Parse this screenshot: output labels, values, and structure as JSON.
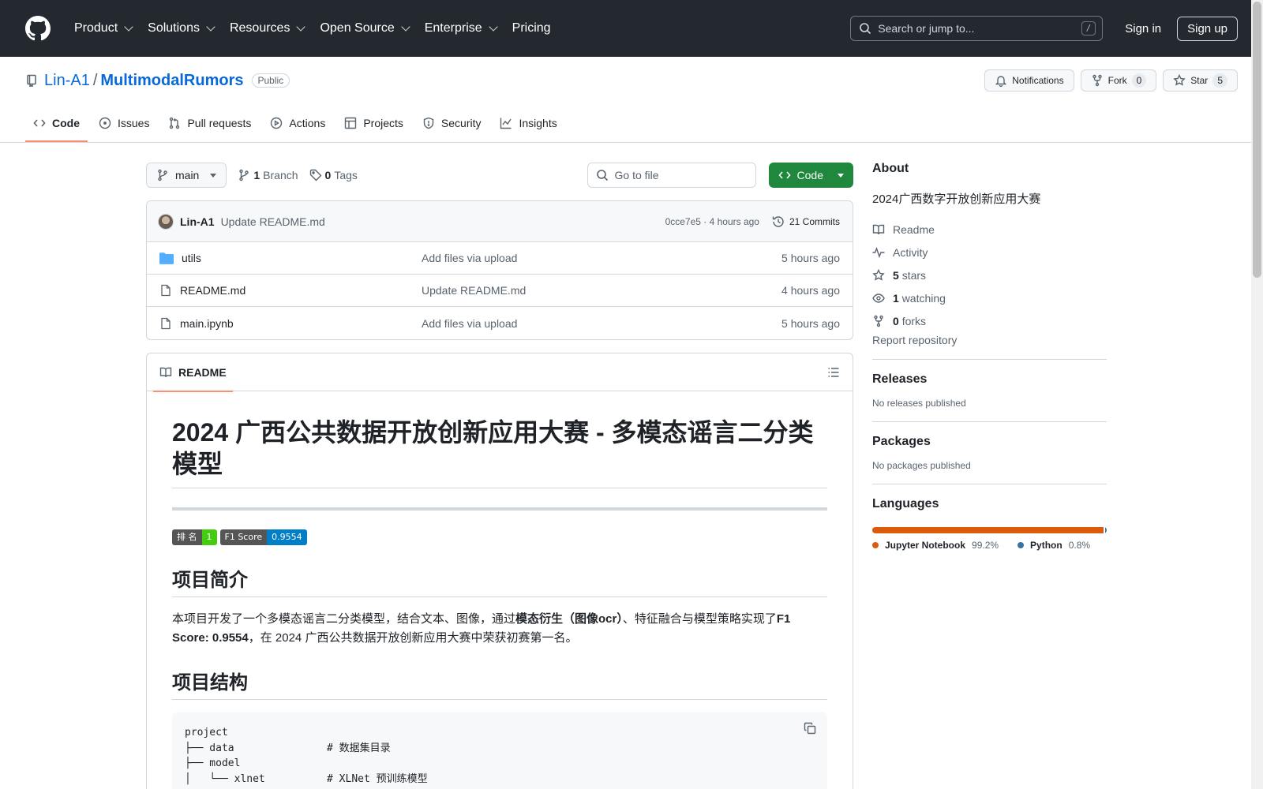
{
  "header": {
    "nav": [
      "Product",
      "Solutions",
      "Resources",
      "Open Source",
      "Enterprise",
      "Pricing"
    ],
    "search_placeholder": "Search or jump to...",
    "slash": "/",
    "sign_in": "Sign in",
    "sign_up": "Sign up"
  },
  "repo": {
    "owner": "Lin-A1",
    "sep": "/",
    "name": "MultimodalRumors",
    "visibility": "Public",
    "notifications": "Notifications",
    "fork_label": "Fork",
    "fork_count": "0",
    "star_label": "Star",
    "star_count": "5",
    "tabs": [
      "Code",
      "Issues",
      "Pull requests",
      "Actions",
      "Projects",
      "Security",
      "Insights"
    ]
  },
  "toolbar": {
    "branch": "main",
    "branch_count": "1",
    "branch_label": "Branch",
    "tag_count": "0",
    "tag_label": "Tags",
    "goto_placeholder": "Go to file",
    "code_button": "Code"
  },
  "commit": {
    "author": "Lin-A1",
    "message": "Update README.md",
    "meta": "0cce7e5 · 4 hours ago",
    "commits": "21 Commits"
  },
  "files": [
    {
      "name": "utils",
      "type": "folder",
      "message": "Add files via upload",
      "time": "5 hours ago"
    },
    {
      "name": "README.md",
      "type": "file",
      "message": "Update README.md",
      "time": "4 hours ago"
    },
    {
      "name": "main.ipynb",
      "type": "file",
      "message": "Add files via upload",
      "time": "5 hours ago"
    }
  ],
  "readme": {
    "tab": "README",
    "title": "2024 广西公共数据开放创新应用大赛 - 多模态谣言二分类模型",
    "badge1_label": "排 名",
    "badge1_value": "1",
    "badge2_label": "F1 Score",
    "badge2_value": "0.9554",
    "h_intro": "项目简介",
    "intro_1": "本项目开发了一个多模态谣言二分类模型，结合文本、图像，通过",
    "intro_bold1": "模态衍生（图像ocr）",
    "intro_2": "、特征融合与模型策略实现了",
    "intro_bold2": "F1 Score: 0.9554",
    "intro_3": "，在 2024 广西公共数据开放创新应用大赛中荣获初赛第一名。",
    "h_struct": "项目结构",
    "code_block": "project\n├── data               # 数据集目录\n├── model\n│   └── xlnet          # XLNet 预训练模型"
  },
  "about": {
    "title": "About",
    "description": "2024广西数字开放创新应用大赛",
    "readme": "Readme",
    "activity": "Activity",
    "stars_count": "5",
    "stars_label": "stars",
    "watching_count": "1",
    "watching_label": "watching",
    "forks_count": "0",
    "forks_label": "forks",
    "report": "Report repository"
  },
  "releases": {
    "title": "Releases",
    "empty": "No releases published"
  },
  "packages": {
    "title": "Packages",
    "empty": "No packages published"
  },
  "languages": {
    "title": "Languages",
    "items": [
      {
        "name": "Jupyter Notebook",
        "percent": "99.2%",
        "fraction": 0.992,
        "color": "#DA5B0B"
      },
      {
        "name": "Python",
        "percent": "0.8%",
        "fraction": 0.008,
        "color": "#3572A5"
      }
    ]
  }
}
